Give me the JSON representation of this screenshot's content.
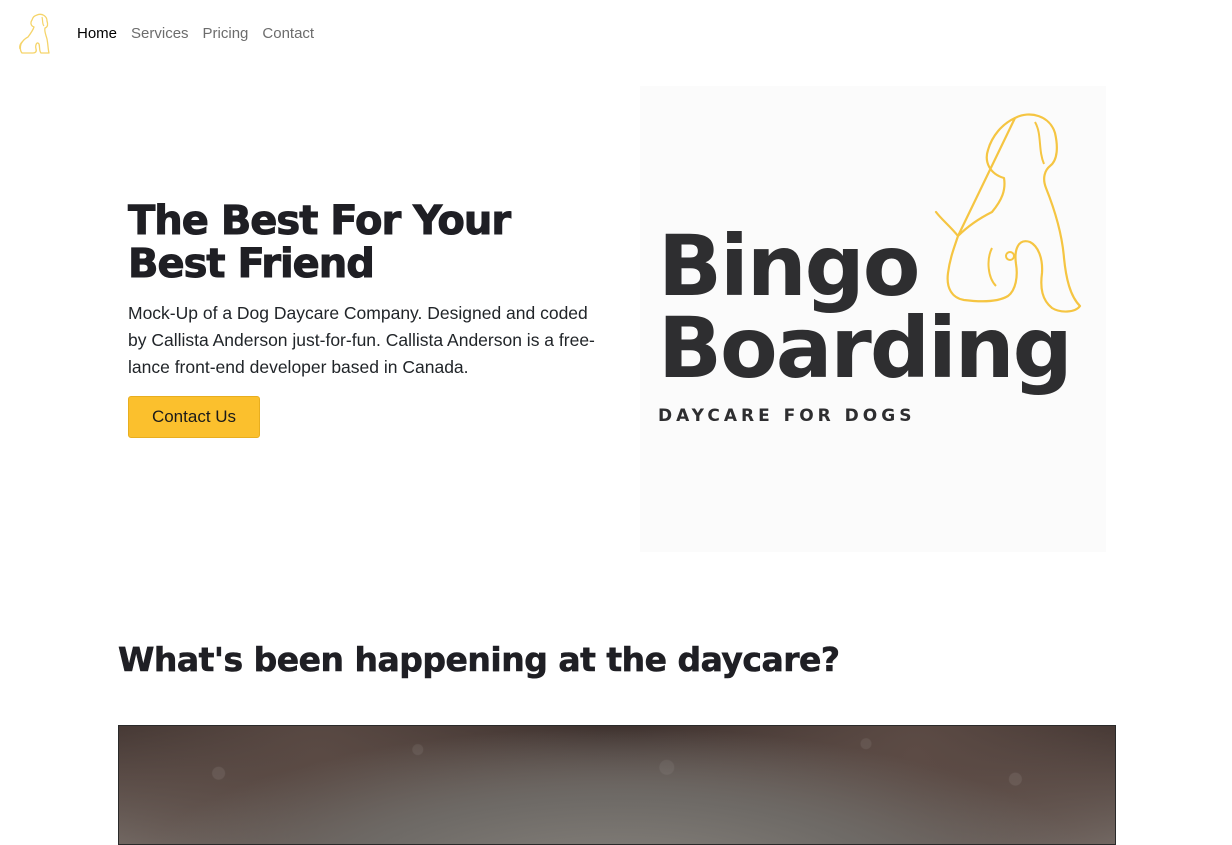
{
  "nav": {
    "brand_icon": "dog-outline-icon",
    "items": [
      {
        "label": "Home",
        "active": true
      },
      {
        "label": "Services",
        "active": false
      },
      {
        "label": "Pricing",
        "active": false
      },
      {
        "label": "Contact",
        "active": false
      }
    ]
  },
  "hero": {
    "title_line1": "The Best For Your",
    "title_line2": "Best Friend",
    "description": "Mock-Up of a Dog Daycare Company. Designed and coded by Callista Anderson just-for-fun. Callista Anderson is a free-lance front-end developer based in Canada.",
    "cta_label": "Contact Us"
  },
  "logo": {
    "word1": "Bingo",
    "word2": "Boarding",
    "tagline": "DAYCARE FOR DOGS",
    "icon": "dog-outline-icon"
  },
  "news": {
    "heading": "What's been happening at the daycare?"
  },
  "colors": {
    "accent": "#fbc02d",
    "text_dark": "#1f1f24",
    "logo_line": "#f5c542"
  }
}
